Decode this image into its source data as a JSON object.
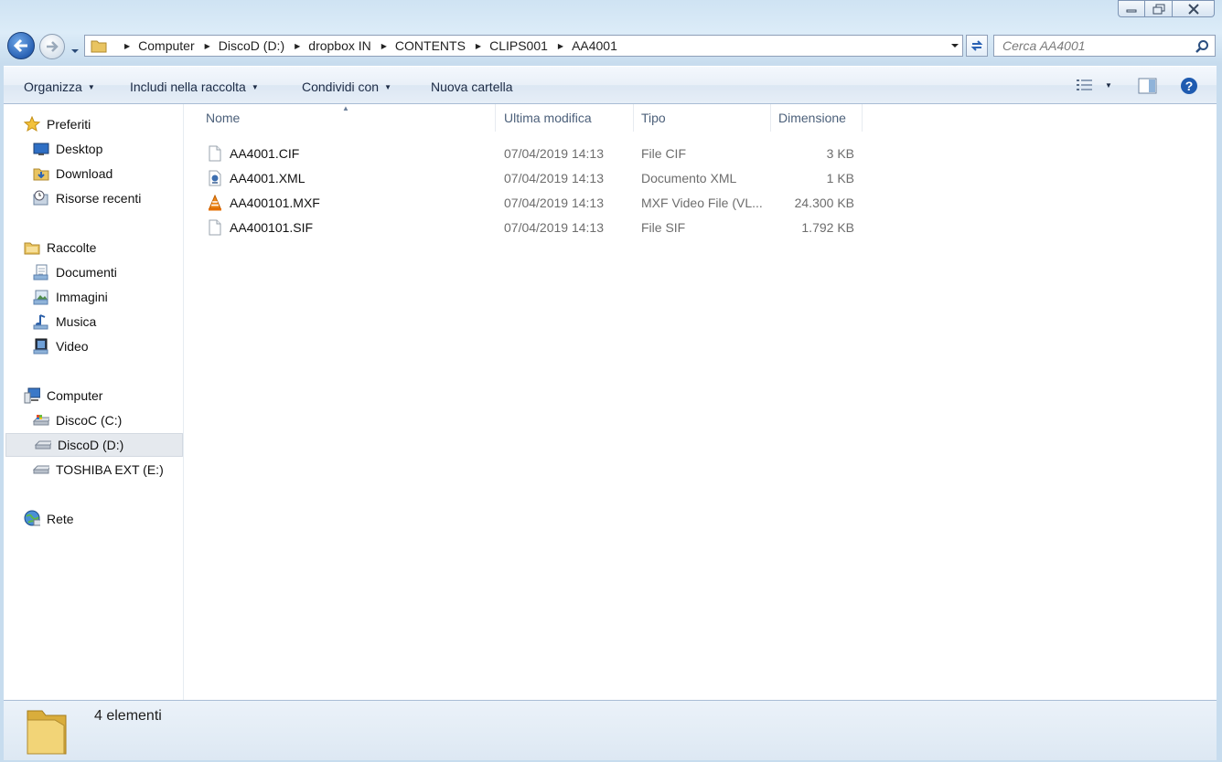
{
  "window": {
    "caption_buttons": [
      "minimize",
      "maximize",
      "close"
    ]
  },
  "address_bar": {
    "crumbs": [
      "Computer",
      "DiscoD (D:)",
      "dropbox IN",
      "CONTENTS",
      "CLIPS001",
      "AA4001"
    ]
  },
  "search": {
    "placeholder": "Cerca AA4001"
  },
  "toolbar": {
    "organize": "Organizza",
    "include": "Includi nella raccolta",
    "share": "Condividi con",
    "new_folder": "Nuova cartella"
  },
  "sidebar": {
    "favorites_header": "Preferiti",
    "favorites": [
      "Desktop",
      "Download",
      "Risorse recenti"
    ],
    "libraries_header": "Raccolte",
    "libraries": [
      "Documenti",
      "Immagini",
      "Musica",
      "Video"
    ],
    "computer_header": "Computer",
    "drives": [
      "DiscoC (C:)",
      "DiscoD (D:)",
      "TOSHIBA EXT (E:)"
    ],
    "selected_drive": "DiscoD (D:)",
    "network": "Rete"
  },
  "columns": {
    "name": "Nome",
    "modified": "Ultima modifica",
    "type": "Tipo",
    "size": "Dimensione"
  },
  "files": [
    {
      "name": "AA4001.CIF",
      "modified": "07/04/2019 14:13",
      "type": "File CIF",
      "size": "3 KB",
      "icon": "blank-file-icon"
    },
    {
      "name": "AA4001.XML",
      "modified": "07/04/2019 14:13",
      "type": "Documento XML",
      "size": "1 KB",
      "icon": "xml-file-icon"
    },
    {
      "name": "AA400101.MXF",
      "modified": "07/04/2019 14:13",
      "type": "MXF Video File (VL...",
      "size": "24.300 KB",
      "icon": "vlc-icon"
    },
    {
      "name": "AA400101.SIF",
      "modified": "07/04/2019 14:13",
      "type": "File SIF",
      "size": "1.792 KB",
      "icon": "blank-file-icon"
    }
  ],
  "status": {
    "count": "4 elementi"
  },
  "colors": {
    "accent": "#2a62b4",
    "selection": "#e5e9ee",
    "muted_text": "#6d6d6d",
    "header_text": "#4c607a"
  }
}
